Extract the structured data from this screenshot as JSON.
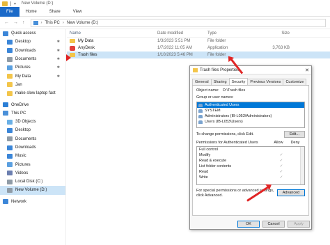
{
  "window": {
    "title": "New Volume (D:)"
  },
  "ribbon": {
    "tabs": [
      "File",
      "Home",
      "Share",
      "View"
    ]
  },
  "address": {
    "crumbs": [
      "This PC",
      "New Volume (D:)"
    ]
  },
  "sidebar": {
    "items": [
      {
        "label": "Quick access",
        "color": "#3b86d8",
        "pinned": false
      },
      {
        "label": "Desktop",
        "color": "#3b86d8",
        "pinned": true
      },
      {
        "label": "Downloads",
        "color": "#3b86d8",
        "pinned": true
      },
      {
        "label": "Documents",
        "color": "#8f9ba6",
        "pinned": true
      },
      {
        "label": "Pictures",
        "color": "#5ba0e0",
        "pinned": true
      },
      {
        "label": "My Data",
        "color": "#f3c54a",
        "pinned": true
      },
      {
        "label": "Jan",
        "color": "#f3c54a",
        "pinned": false
      },
      {
        "label": "make slow laptop fast",
        "color": "#f3c54a",
        "pinned": false
      },
      {
        "label": "OneDrive",
        "color": "#2b7fd6",
        "pinned": false
      },
      {
        "label": "This PC",
        "color": "#4a90d9",
        "pinned": false
      },
      {
        "label": "3D Objects",
        "color": "#6ab0e6",
        "pinned": false
      },
      {
        "label": "Desktop",
        "color": "#3b86d8",
        "pinned": false
      },
      {
        "label": "Documents",
        "color": "#8f9ba6",
        "pinned": false
      },
      {
        "label": "Downloads",
        "color": "#3b86d8",
        "pinned": false
      },
      {
        "label": "Music",
        "color": "#3b86d8",
        "pinned": false
      },
      {
        "label": "Pictures",
        "color": "#5ba0e0",
        "pinned": false
      },
      {
        "label": "Videos",
        "color": "#6c7fb0",
        "pinned": false
      },
      {
        "label": "Local Disk (C:)",
        "color": "#8f9ba6",
        "pinned": false
      },
      {
        "label": "New Volume (D:)",
        "color": "#8f9ba6",
        "pinned": false,
        "selected": true
      },
      {
        "label": "Network",
        "color": "#3b86d8",
        "pinned": false
      }
    ]
  },
  "files": {
    "headers": [
      "Name",
      "Date modified",
      "Type",
      "Size"
    ],
    "rows": [
      {
        "name": "My Data",
        "date": "1/3/2023 5:51 PM",
        "type": "File folder",
        "size": "",
        "icon": "folder"
      },
      {
        "name": "AnyDesk",
        "date": "1/7/2022 11:05 AM",
        "type": "Application",
        "size": "3,763 KB",
        "icon": "app"
      },
      {
        "name": "Trash files",
        "date": "1/10/2023 5:46 PM",
        "type": "File folder",
        "size": "",
        "icon": "folder",
        "selected": true
      }
    ]
  },
  "dialog": {
    "title": "Trash files Properties",
    "tabs": [
      "General",
      "Sharing",
      "Security",
      "Previous Versions",
      "Customize"
    ],
    "object_label": "Object name:",
    "object_value": "D:\\Trash files",
    "groups_label": "Group or user names:",
    "groups": [
      "Authenticated Users",
      "SYSTEM",
      "Administrators (IB-L053\\Administrators)",
      "Users (IB-L053\\Users)"
    ],
    "edit_hint": "To change permissions, click Edit.",
    "edit_button": "Edit...",
    "perm_label": "Permissions for Authenticated Users",
    "allow_label": "Allow",
    "deny_label": "Deny",
    "permissions": [
      {
        "name": "Full control",
        "allow": ""
      },
      {
        "name": "Modify",
        "allow": "✓"
      },
      {
        "name": "Read & execute",
        "allow": "✓"
      },
      {
        "name": "List folder contents",
        "allow": "✓"
      },
      {
        "name": "Read",
        "allow": "✓"
      },
      {
        "name": "Write",
        "allow": "✓"
      }
    ],
    "advanced_hint": "For special permissions or advanced settings, click Advanced.",
    "advanced_button": "Advanced",
    "ok": "OK",
    "cancel": "Cancel",
    "apply": "Apply"
  },
  "accent": "#e02424"
}
